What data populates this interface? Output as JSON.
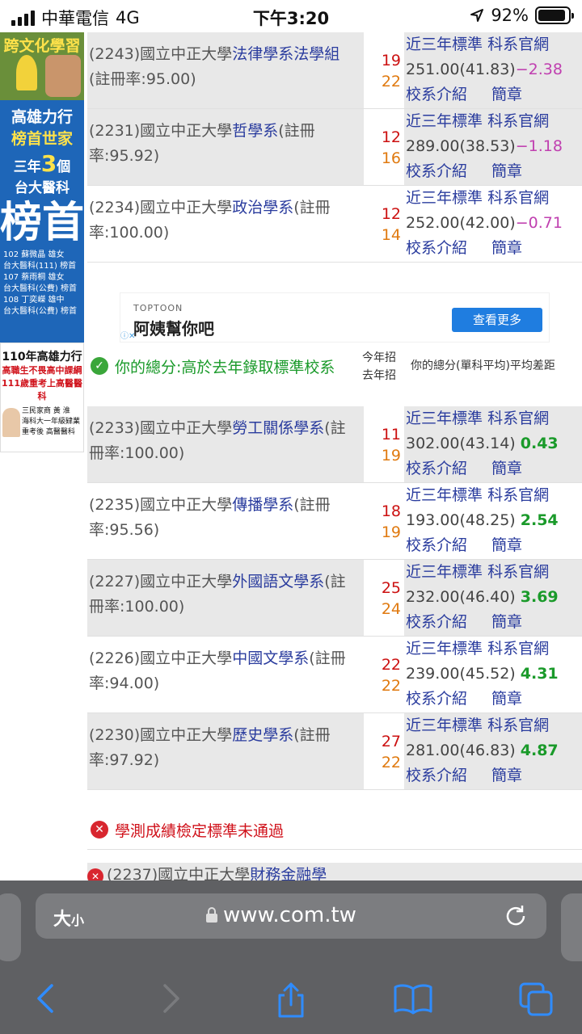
{
  "status": {
    "carrier": "中華電信",
    "network": "4G",
    "time": "下午3:20",
    "battery": "92%",
    "battery_level": 0.92
  },
  "left_ads": {
    "ad1_title": "跨文化學習",
    "ad2": {
      "line1": "高雄力行",
      "line2": "榜首世家",
      "line3_a": "三年",
      "line3_num": "3",
      "line3_b": "個",
      "line4": "台大醫科",
      "big": "榜首",
      "names": [
        {
          "name": "102 蘇微晶 雄女",
          "tag": "台大醫科(111) 榜首"
        },
        {
          "name": "107 蔡雨桐 雄女",
          "tag": "台大醫科(公費) 榜首"
        },
        {
          "name": "108 丁奕嶸 雄中",
          "tag": "台大醫科(公費) 榜首"
        }
      ]
    },
    "ad3": {
      "head": "110年高雄力行",
      "r1": "高職生不畏高中課綱",
      "r2": "111歲重考上高醫醫科",
      "school": "三民家商 黃 淮",
      "note": "海科大一年級肄業",
      "target": "重考後 高醫醫科"
    }
  },
  "rows_top": [
    {
      "code": "(2243)國立中正大學",
      "dept": "法律學系法學組",
      "rate": "(註冊率:95.00)",
      "this_year": "19",
      "last_year": "22",
      "score_label": "近三年標準",
      "site_label": "科系官網",
      "score": "251.00(41.83)",
      "diff": "−2.38",
      "intro": "校系介紹",
      "brief": "簡章"
    },
    {
      "code": "(2231)國立中正大學",
      "dept": "哲學系",
      "rate": "(註冊率:95.92)",
      "this_year": "12",
      "last_year": "16",
      "score_label": "近三年標準",
      "site_label": "科系官網",
      "score": "289.00(38.53)",
      "diff": "−1.18",
      "intro": "校系介紹",
      "brief": "簡章"
    },
    {
      "code": "(2234)國立中正大學",
      "dept": "政治學系",
      "rate": "(註冊率:100.00)",
      "this_year": "12",
      "last_year": "14",
      "score_label": "近三年標準",
      "site_label": "科系官網",
      "score": "252.00(42.00)",
      "diff": "−0.71",
      "intro": "校系介紹",
      "brief": "簡章"
    }
  ],
  "ad_banner": {
    "source": "TOPTOON",
    "title": "阿姨幫你吧",
    "button": "查看更多"
  },
  "section_head": {
    "label": "你的總分:高於去年錄取標準校系",
    "this_year": "今年招",
    "last_year": "去年招",
    "diff_label": "你的總分(單科平均)平均差距"
  },
  "rows_bottom": [
    {
      "code": "(2233)國立中正大學",
      "dept": "勞工關係學系",
      "rate": "(註冊率:100.00)",
      "this_year": "11",
      "last_year": "19",
      "score_label": "近三年標準",
      "site_label": "科系官網",
      "score": "302.00(43.14)",
      "diff": "0.43",
      "intro": "校系介紹",
      "brief": "簡章"
    },
    {
      "code": "(2235)國立中正大學",
      "dept": "傳播學系",
      "rate": "(註冊率:95.56)",
      "this_year": "18",
      "last_year": "19",
      "score_label": "近三年標準",
      "site_label": "科系官網",
      "score": "193.00(48.25)",
      "diff": "2.54",
      "intro": "校系介紹",
      "brief": "簡章"
    },
    {
      "code": "(2227)國立中正大學",
      "dept": "外國語文學系",
      "rate": "(註冊率:100.00)",
      "this_year": "25",
      "last_year": "24",
      "score_label": "近三年標準",
      "site_label": "科系官網",
      "score": "232.00(46.40)",
      "diff": "3.69",
      "intro": "校系介紹",
      "brief": "簡章"
    },
    {
      "code": "(2226)國立中正大學",
      "dept": "中國文學系",
      "rate": "(註冊率:94.00)",
      "this_year": "22",
      "last_year": "22",
      "score_label": "近三年標準",
      "site_label": "科系官網",
      "score": "239.00(45.52)",
      "diff": "4.31",
      "intro": "校系介紹",
      "brief": "簡章"
    },
    {
      "code": "(2230)國立中正大學",
      "dept": "歷史學系",
      "rate": "(註冊率:97.92)",
      "this_year": "27",
      "last_year": "22",
      "score_label": "近三年標準",
      "site_label": "科系官網",
      "score": "281.00(46.83)",
      "diff": "4.87",
      "intro": "校系介紹",
      "brief": "簡章"
    }
  ],
  "fail_section": {
    "label": "學測成績檢定標準未通過",
    "partial_code": "(2237)國立中正大學",
    "partial_dept": "財務金融學"
  },
  "browser": {
    "text_size": "大",
    "text_size_small": "小",
    "url": "www.com.tw"
  }
}
